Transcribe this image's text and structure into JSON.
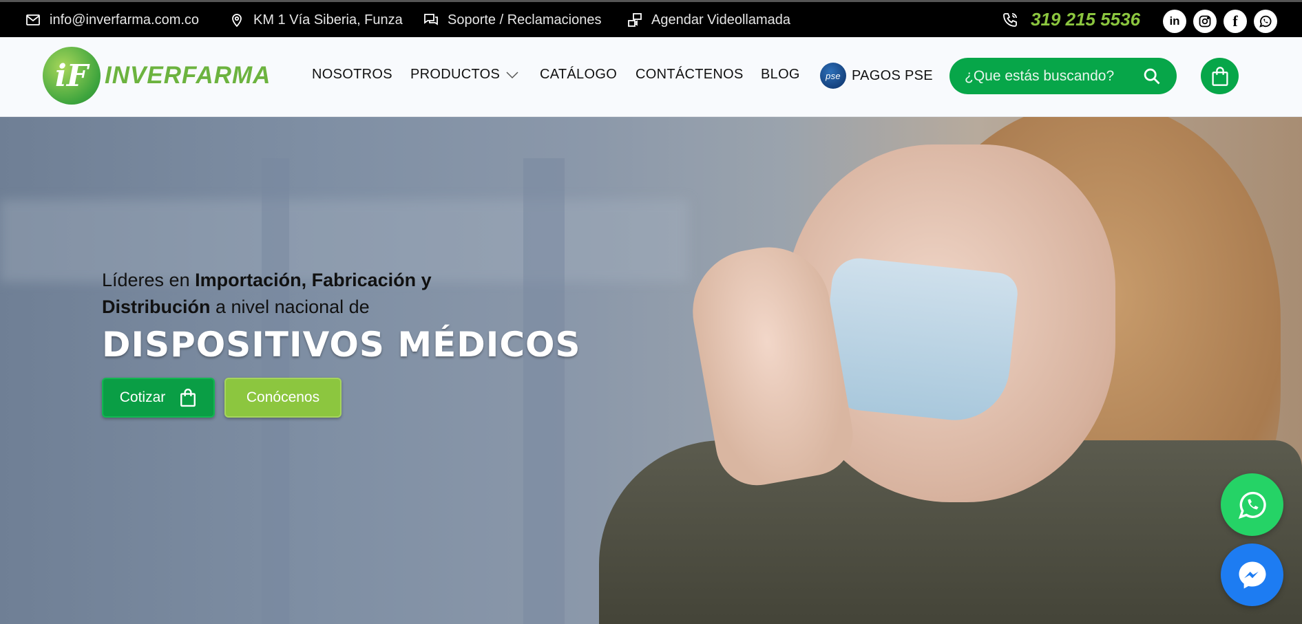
{
  "topbar": {
    "email": "info@inverfarma.com.co",
    "address": "KM 1 Vía Siberia, Funza",
    "support": "Soporte / Reclamaciones",
    "video": "Agendar Videollamada",
    "phone": "319 215 5536",
    "socials": [
      "linkedin-icon",
      "instagram-icon",
      "facebook-icon",
      "whatsapp-icon"
    ]
  },
  "header": {
    "logo_text": "INVERFARMA",
    "nav": {
      "nosotros": "NOSOTROS",
      "productos": "PRODUCTOS",
      "catalogo": "CATÁLOGO",
      "contactenos": "CONTÁCTENOS",
      "blog": "BLOG",
      "pse_badge": "pse",
      "pagos_pse": "PAGOS PSE"
    },
    "search_placeholder": "¿Que estás buscando?"
  },
  "hero": {
    "line1_a": "Líderes en ",
    "line1_b": "Importación, Fabricación y",
    "line2_a": "Distribución",
    "line2_b": " a nivel nacional de",
    "title": "DISPOSITIVOS MÉDICOS",
    "btn_cotizar": "Cotizar",
    "btn_conocenos": "Conócenos"
  },
  "colors": {
    "brand_green": "#07a649",
    "accent_lime": "#8cc63f",
    "whatsapp": "#25d366",
    "messenger": "#1d7cf2"
  }
}
